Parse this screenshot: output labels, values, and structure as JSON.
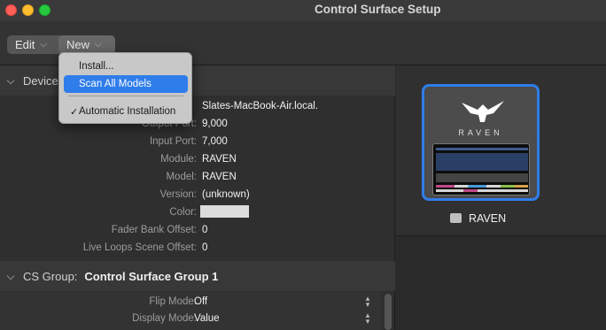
{
  "window": {
    "title": "Control Surface Setup"
  },
  "toolbar": {
    "edit_label": "Edit",
    "new_label": "New"
  },
  "new_menu": {
    "items": [
      {
        "label": "Install..."
      },
      {
        "label": "Scan All Models"
      },
      {
        "label": "Automatic Installation",
        "checked": true
      }
    ]
  },
  "device_section": {
    "label": "Device",
    "properties": [
      {
        "label": "",
        "value": "Slates-MacBook-Air.local."
      },
      {
        "label": "Output Port:",
        "value": "9,000"
      },
      {
        "label": "Input Port:",
        "value": "7,000"
      },
      {
        "label": "Module:",
        "value": "RAVEN"
      },
      {
        "label": "Model:",
        "value": "RAVEN"
      },
      {
        "label": "Version:",
        "value": "(unknown)"
      },
      {
        "label": "Color:",
        "value": ""
      },
      {
        "label": "Fader Bank Offset:",
        "value": "0"
      },
      {
        "label": "Live Loops Scene Offset:",
        "value": "0"
      }
    ]
  },
  "cs_group_section": {
    "label": "CS Group:",
    "value": "Control Surface Group 1",
    "properties": [
      {
        "label": "Flip Mode:",
        "value": "Off"
      },
      {
        "label": "Display Mode:",
        "value": "Value"
      }
    ]
  },
  "device_tile": {
    "brand_text": "RAVEN",
    "name": "RAVEN"
  },
  "colors": {
    "accent": "#2f7dea",
    "device_color_swatch": "#dcdcdc"
  }
}
